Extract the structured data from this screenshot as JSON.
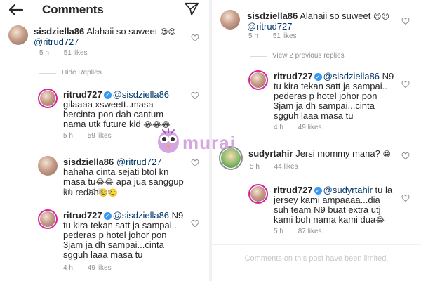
{
  "header": {
    "title": "Comments"
  },
  "left": {
    "comments": [
      {
        "user": "sisdziella86",
        "text": "Alahaii so suweet",
        "emoji": "😍😍",
        "mention": "@ritrud727",
        "time": "5 h",
        "likes": "51 likes"
      },
      {
        "user": "ritrud727",
        "mention": "@sisdziella86",
        "text": "gilaaaa xsweett..masa bercinta pon dah cantum nama utk future kid",
        "emoji": "😂😂😂",
        "time": "5 h",
        "likes": "59 likes"
      },
      {
        "user": "sisdziella86",
        "mention": "@ritrud727",
        "text": "hahaha cinta sejati btol kn masa tu",
        "emoji": "😂😂",
        "text2": "apa jua sanggup ku redah",
        "emoji2": "🙂🙂",
        "time": "5 h",
        "likes": "19 likes"
      },
      {
        "user": "ritrud727",
        "mention": "@sisdziella86",
        "text": "N9 tu kira tekan satt ja sampai.. pederas p hotel johor pon 3jam ja dh sampai...cinta sgguh laaa masa tu",
        "time": "4 h",
        "likes": "49 likes"
      }
    ],
    "hide_replies": "Hide Replies"
  },
  "right": {
    "comments": [
      {
        "user": "sisdziella86",
        "text": "Alahaii so suweet",
        "emoji": "😍😍",
        "mention": "@ritrud727",
        "time": "5 h",
        "likes": "51 likes"
      },
      {
        "user": "ritrud727",
        "mention": "@sisdziella86",
        "text": "N9 tu kira tekan satt ja sampai.. pederas p hotel johor pon 3jam ja dh sampai...cinta sgguh laaa masa tu",
        "time": "4 h",
        "likes": "49 likes"
      },
      {
        "user": "sudyrtahir",
        "text": "Jersi mommy mana?",
        "emoji": "😀",
        "time": "5 h",
        "likes": "44 likes"
      },
      {
        "user": "ritrud727",
        "mention": "@sudyrtahir",
        "text": "tu la jersey kami ampaaaa...dia suh team N9 buat extra utj kami boh nama kami dua",
        "emoji": "😂",
        "time": "5 h",
        "likes": "87 likes"
      }
    ],
    "view_previous": "View 2 previous replies",
    "limited": "Comments on this post have been limited."
  },
  "watermark": {
    "text": "murai"
  },
  "colors": {
    "mention": "#00376b",
    "meta": "#8e8e8e",
    "verified": "#3897f0"
  }
}
